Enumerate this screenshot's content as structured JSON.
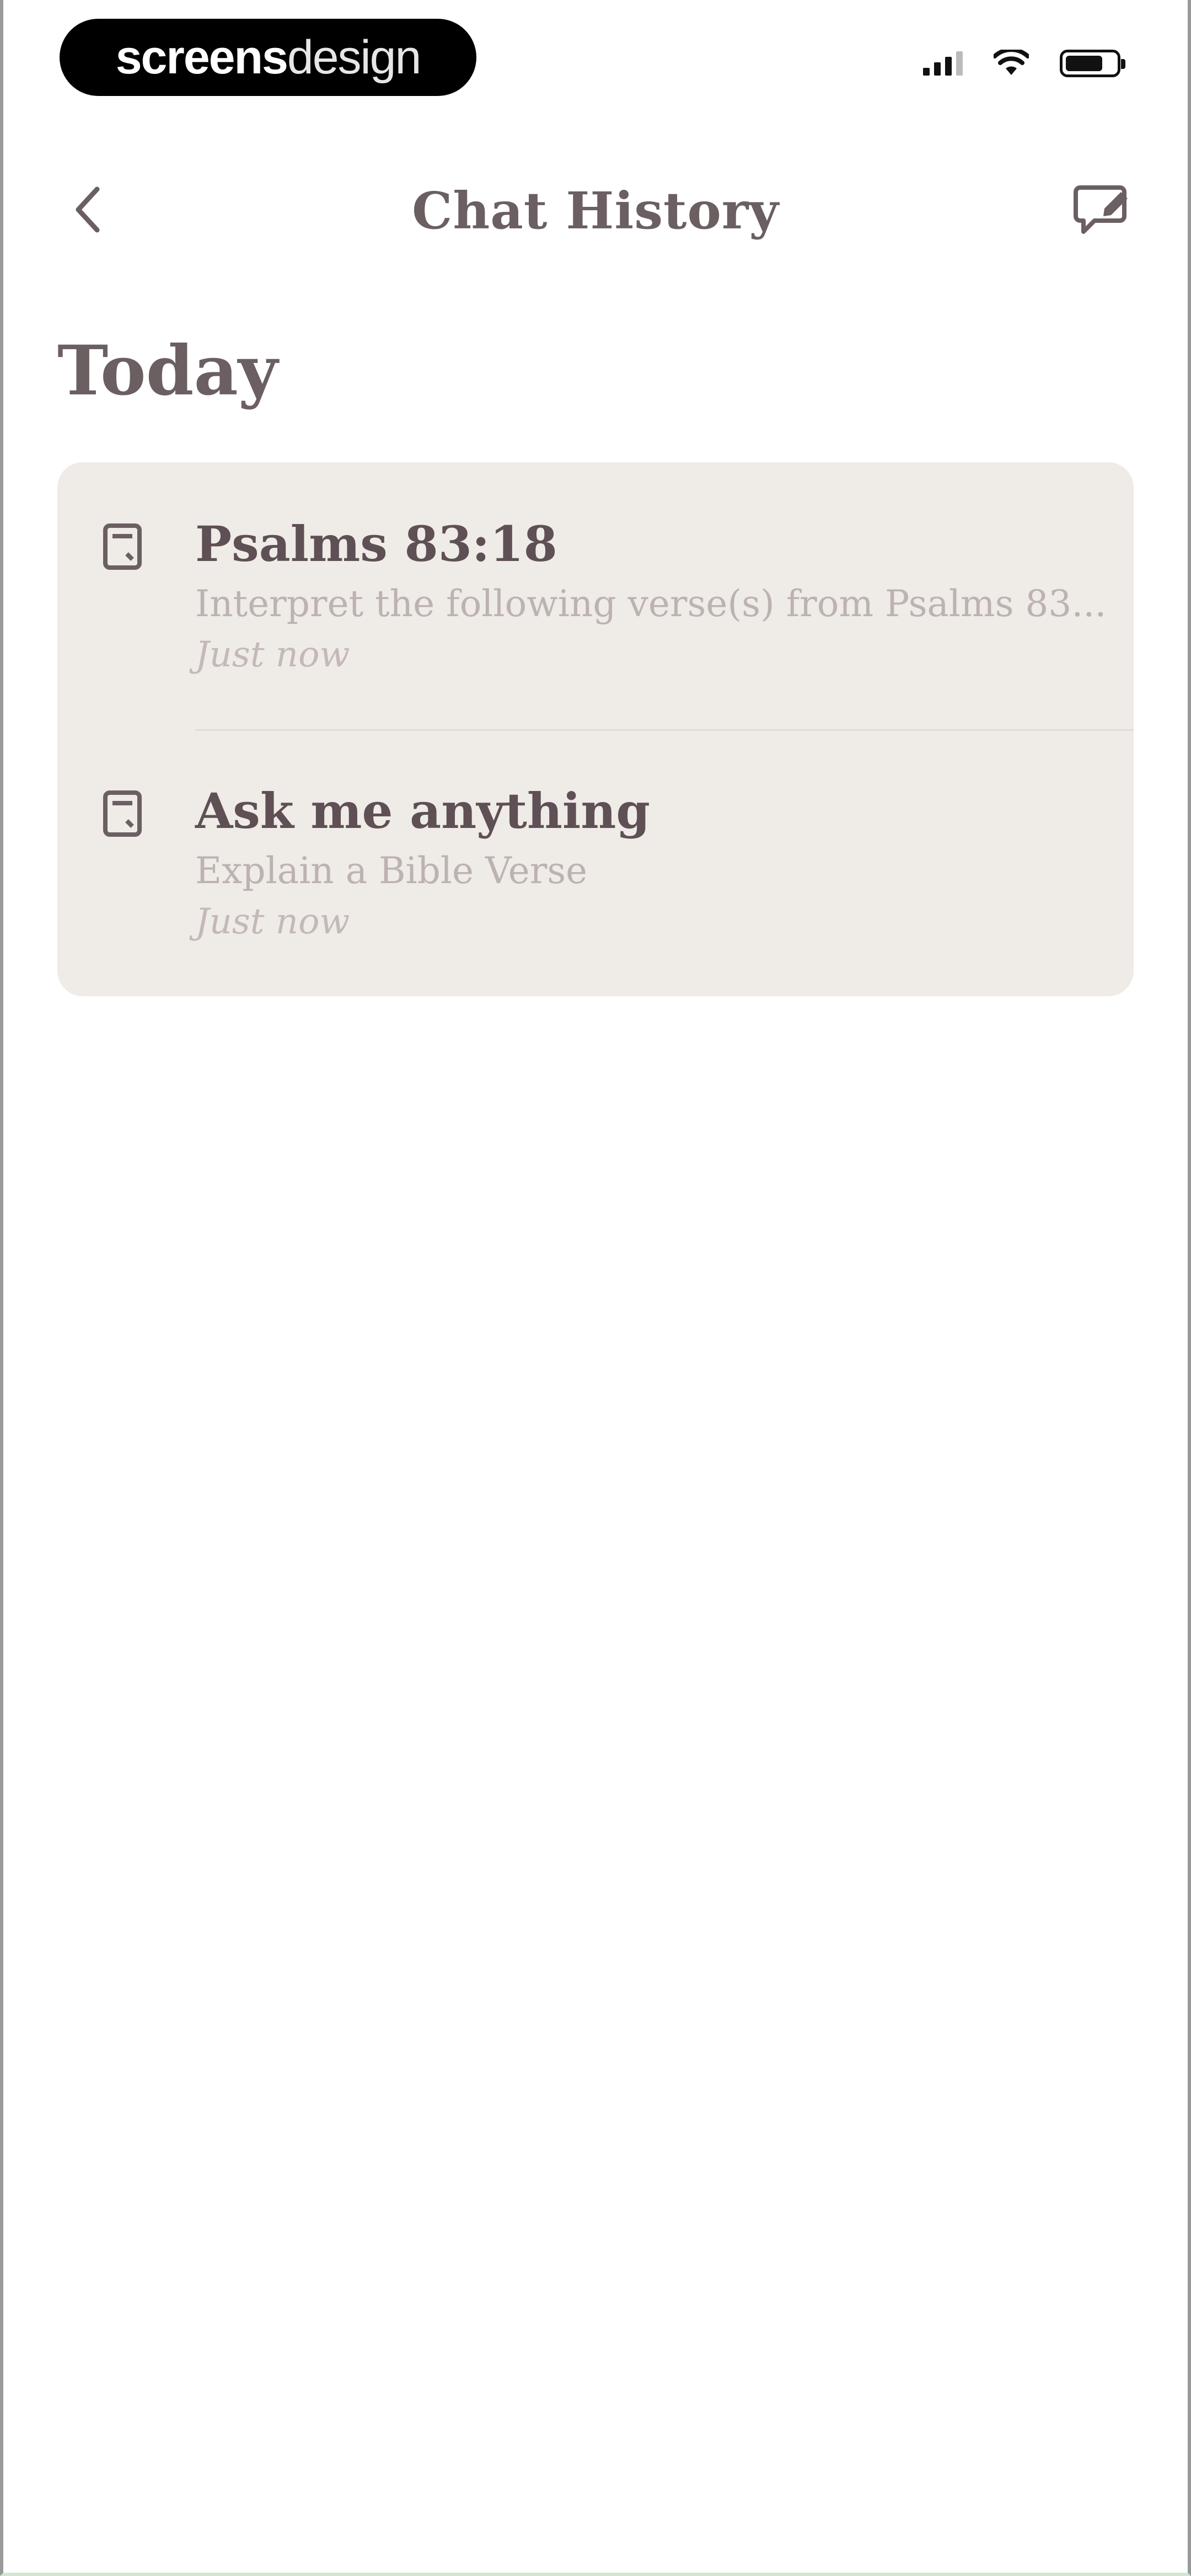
{
  "status_bar": {
    "brand_strong": "screens",
    "brand_light": "design"
  },
  "nav": {
    "title": "Chat History"
  },
  "section": {
    "title": "Today"
  },
  "chats": [
    {
      "title": "Psalms 83:18",
      "subtitle": "Interpret the following verse(s) from Psalms 83...",
      "time": "Just now"
    },
    {
      "title": "Ask me anything",
      "subtitle": "Explain a Bible Verse",
      "time": "Just now"
    }
  ],
  "colors": {
    "card_background": "#efebe7",
    "title_text": "#5e5054",
    "muted_text": "#bdb2b2"
  },
  "icons": {
    "back": "chevron-left-icon",
    "new_chat": "new-chat-icon",
    "chat_item": "document-icon"
  }
}
